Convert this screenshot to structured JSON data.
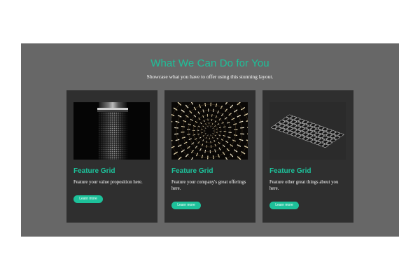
{
  "section": {
    "title": "What We Can Do for You",
    "subtitle": "Showcase what you have to offer using this stunning layout."
  },
  "colors": {
    "accent": "#1dc19a",
    "section_bg": "#676767",
    "card_bg": "#2f2f2f"
  },
  "cards": [
    {
      "image": "microphone-photo",
      "title": "Feature Grid",
      "text": "Feature your value proposition here.",
      "button": "Learn more"
    },
    {
      "image": "concentric-light-tunnel-photo",
      "title": "Feature Grid",
      "text": "Feature your company's great offerings here.",
      "button": "Learn more"
    },
    {
      "image": "backlit-keyboard-photo",
      "title": "Feature Grid",
      "text": "Feature other great things about you here.",
      "button": "Learn more"
    }
  ]
}
